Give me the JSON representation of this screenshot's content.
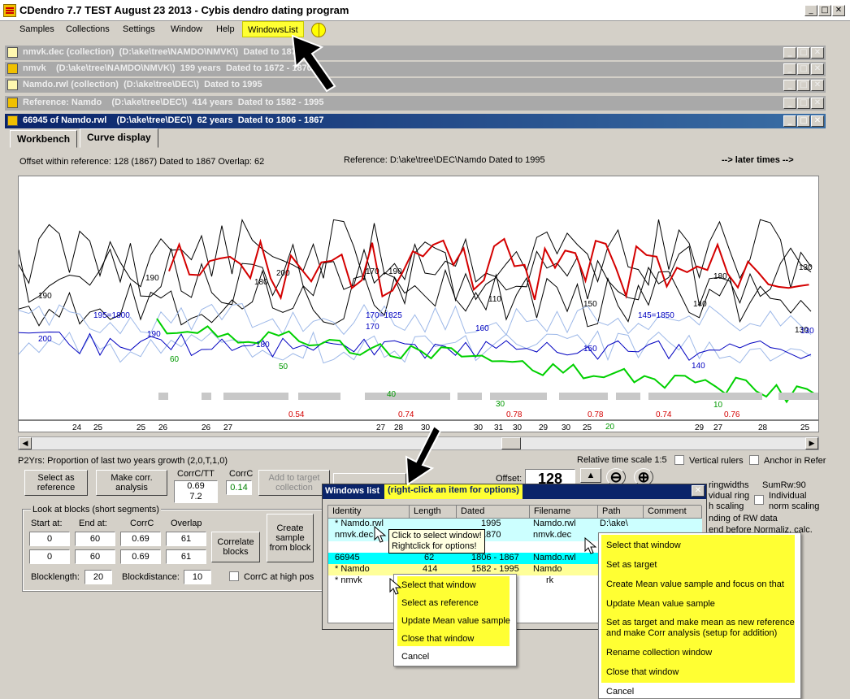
{
  "app": {
    "title": "CDendro 7.7 TEST August 23 2013 - Cybis dendro dating program"
  },
  "menu": {
    "items": [
      "Samples",
      "Collections",
      "Settings",
      "Window",
      "Help"
    ],
    "highlight": "WindowsList"
  },
  "mdi": [
    {
      "title": "nmvk.dec (collection)  (D:\\ake\\tree\\NAMDO\\NMVK\\)  Dated to 1870"
    },
    {
      "title": "nmvk    (D:\\ake\\tree\\NAMDO\\NMVK\\)  199 years  Dated to 1672 - 1870"
    },
    {
      "title": "Namdo.rwl (collection)  (D:\\ake\\tree\\DEC\\)  Dated to 1995"
    },
    {
      "title": "Reference: Namdo    (D:\\ake\\tree\\DEC\\)  414 years  Dated to 1582 - 1995"
    },
    {
      "title": "66945 of Namdo.rwl    (D:\\ake\\tree\\DEC\\)  62 years  Dated to 1806 - 1867"
    }
  ],
  "tabs": [
    "Workbench",
    "Curve display"
  ],
  "info": {
    "offset": "Offset within reference:   128  (1867)   Dated to 1867  Overlap: 62",
    "reference": "Reference: D:\\ake\\tree\\DEC\\Namdo  Dated to 1995",
    "later": "--> later times -->"
  },
  "chart_labels": {
    "upper": [
      "190",
      "180",
      "190",
      "200",
      "170",
      "190",
      "150",
      "130",
      "180",
      "140",
      "110",
      "130"
    ],
    "blue": [
      "195=1800",
      "200",
      "170=1825",
      "170",
      "160",
      "145=1850",
      "150",
      "140",
      "130",
      "190",
      "180"
    ],
    "green": [
      "60",
      "50",
      "40",
      "30",
      "20",
      "10"
    ],
    "red": [
      "0.54",
      "0.74",
      "0.78",
      "0.78",
      "0.74",
      "0.76"
    ],
    "axis": [
      "24",
      "25",
      "25",
      "26",
      "26",
      "27",
      "27",
      "28",
      "30",
      "30",
      "31",
      "30",
      "29",
      "30",
      "25",
      "29",
      "27",
      "28",
      "25"
    ]
  },
  "p2yrs": "P2Yrs: Proportion of last two years growth (2,0,T,1,0)",
  "rel_scale": "Relative time scale 1:5",
  "vertical_rulers": "Vertical rulers",
  "anchor": "Anchor in Refer",
  "buttons": {
    "select_ref": "Select as reference",
    "make_corr": "Make corr. analysis",
    "add_target": "Add to target collection",
    "correlate": "Correlate blocks",
    "create_sample": "Create sample from block"
  },
  "corrc_tt": {
    "label": "CorrC/TT",
    "v1": "0.69",
    "v2": "7.2"
  },
  "corrc": {
    "label": "CorrC",
    "value": "0.14"
  },
  "offset": {
    "label": "Offset:",
    "value": "128"
  },
  "blocks": {
    "title": "Look at blocks (short segments)",
    "headers": [
      "Start at:",
      "End at:",
      "CorrC",
      "Overlap"
    ],
    "rows": [
      [
        "0",
        "60",
        "0.69",
        "61"
      ],
      [
        "0",
        "60",
        "0.69",
        "61"
      ]
    ],
    "blocklength_label": "Blocklength:",
    "blocklength": "20",
    "blockdistance_label": "Blockdistance:",
    "blockdistance": "10",
    "corrc_high": "CorrC at high pos"
  },
  "right_opts": {
    "ringwidths": "ringwidths",
    "vidual_ring": "vidual ring",
    "h_scaling": "h scaling",
    "sumrw": "SumRw:90",
    "individual": "Individual",
    "norm": "norm scaling",
    "ending": "nding of RW data",
    "before": "end before Normaliz. calc."
  },
  "windows_list": {
    "title": "Windows list",
    "hint": "(right-click an item for options)",
    "columns": [
      "Identity",
      "Length",
      "Dated",
      "Filename",
      "Path",
      "Comment"
    ],
    "rows": [
      {
        "id": "* Namdo.rwl",
        "len": "",
        "dated": "1995",
        "file": "Namdo.rwl",
        "path": "D:\\ake\\"
      },
      {
        "id": "  nmvk.dec",
        "len": "",
        "dated": "1870",
        "file": "nmvk.dec",
        "path": ""
      },
      {
        "id": "  66945",
        "len": "62",
        "dated": "1806 - 1867",
        "file": "Namdo.rwl",
        "path": ""
      },
      {
        "id": "* Namdo",
        "len": "414",
        "dated": "1582 - 1995",
        "file": "Namdo",
        "path": ""
      },
      {
        "id": "* nmvk",
        "len": "",
        "dated": "",
        "file": "rk",
        "path": ""
      }
    ],
    "tooltip": [
      "Click to select window!",
      "Rightclick for options!"
    ]
  },
  "ctx_small": [
    "Select that window",
    "Select as reference",
    "Update Mean value sample",
    "Close that window",
    "Cancel"
  ],
  "ctx_big": [
    "Select that window",
    "Set as target",
    "Create Mean value sample and focus on that",
    "Update Mean value sample",
    "Set as target and make mean as new reference",
    "and make Corr analysis (setup for addition)",
    "Rename collection window",
    "Close that window",
    "Cancel"
  ],
  "colors": {
    "red": "#d40000",
    "green": "#00d000",
    "blue": "#0000c0",
    "lightblue": "#9db8e8",
    "yellow": "#ffff33",
    "cyan": "#00ffff"
  }
}
